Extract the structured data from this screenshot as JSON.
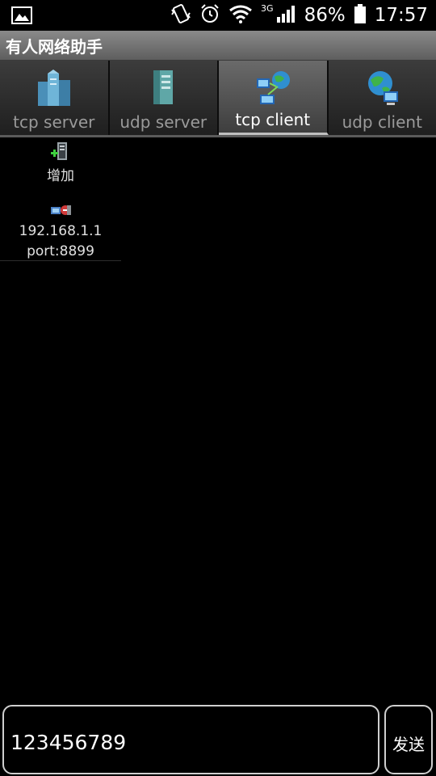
{
  "status_bar": {
    "network": "3G",
    "battery": "86%",
    "time": "17:57"
  },
  "app": {
    "title": "有人网络助手"
  },
  "tabs": [
    {
      "label": "tcp server",
      "icon": "tcp-server-icon",
      "active": false
    },
    {
      "label": "udp server",
      "icon": "udp-server-icon",
      "active": false
    },
    {
      "label": "tcp client",
      "icon": "tcp-client-icon",
      "active": true
    },
    {
      "label": "udp client",
      "icon": "udp-client-icon",
      "active": false
    }
  ],
  "items": {
    "add_label": "增加",
    "connection": {
      "ip": "192.168.1.1",
      "port": "port:8899"
    }
  },
  "input": {
    "value": "123456789"
  },
  "send_label": "发送"
}
